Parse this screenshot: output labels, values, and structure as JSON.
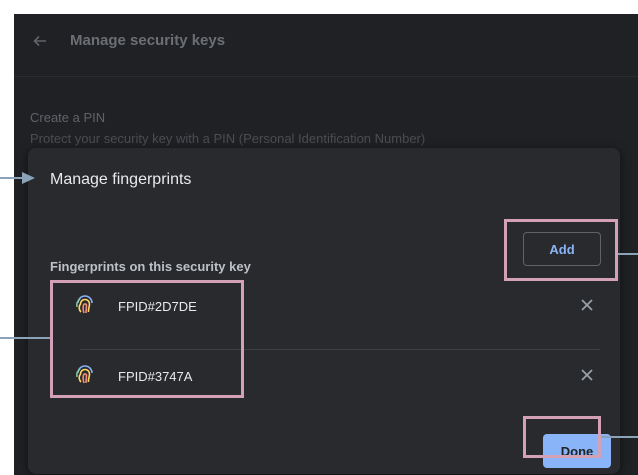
{
  "settings": {
    "title": "Manage security keys",
    "pin_title": "Create a PIN",
    "pin_description": "Protect your security key with a PIN (Personal Identification Number)"
  },
  "dialog": {
    "title": "Manage fingerprints",
    "section_label": "Fingerprints on this security key",
    "add_label": "Add",
    "done_label": "Done",
    "fingerprints": [
      {
        "name": "FPID#2D7DE"
      },
      {
        "name": "FPID#3747A"
      }
    ]
  },
  "colors": {
    "page_bg": "#202124",
    "dialog_bg": "#292a2d",
    "accent": "#8ab4f8",
    "highlight": "#d4a0b6"
  },
  "icons": [
    "back-arrow-icon",
    "fingerprint-icon",
    "close-icon"
  ]
}
